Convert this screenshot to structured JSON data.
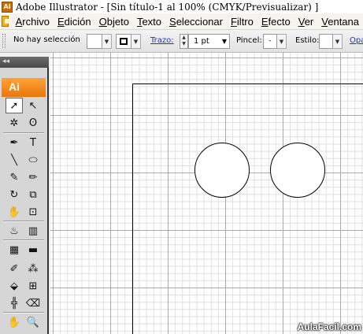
{
  "window": {
    "logo": "Ai",
    "title": "Adobe Illustrator - [Sin título-1 al 100% (CMYK/Previsualizar) ]"
  },
  "menubar": {
    "items": [
      "Archivo",
      "Edición",
      "Objeto",
      "Texto",
      "Seleccionar",
      "Filtro",
      "Efecto",
      "Ver",
      "Ventana"
    ]
  },
  "controlbar": {
    "selection_status": "No hay selección",
    "fill_color": "#ffffff",
    "stroke_color": "#000000",
    "stroke_label": "Trazo:",
    "stroke_weight": "1 pt",
    "brush_label": "Pincel:",
    "brush_value": "-",
    "style_label": "Estilo:",
    "opacity_label": "Opa"
  },
  "tools_panel": {
    "collapse_glyph": "◂◂",
    "logo": "Ai",
    "tools": [
      {
        "name": "selection-tool",
        "glyph": "➚",
        "active": true
      },
      {
        "name": "direct-selection-tool",
        "glyph": "↖"
      },
      {
        "name": "magic-wand-tool",
        "glyph": "✲"
      },
      {
        "name": "lasso-tool",
        "glyph": "ʘ"
      },
      {
        "name": "pen-tool",
        "glyph": "✒"
      },
      {
        "name": "type-tool",
        "glyph": "T"
      },
      {
        "name": "line-tool",
        "glyph": "╲"
      },
      {
        "name": "ellipse-tool",
        "glyph": "⬭"
      },
      {
        "name": "paintbrush-tool",
        "glyph": "✎"
      },
      {
        "name": "pencil-tool",
        "glyph": "✏"
      },
      {
        "name": "rotate-tool",
        "glyph": "↻"
      },
      {
        "name": "scale-tool",
        "glyph": "⧉"
      },
      {
        "name": "warp-tool",
        "glyph": "✋"
      },
      {
        "name": "free-transform-tool",
        "glyph": "⊡"
      },
      {
        "name": "symbol-sprayer-tool",
        "glyph": "♨"
      },
      {
        "name": "column-graph-tool",
        "glyph": "▥"
      },
      {
        "name": "mesh-tool",
        "glyph": "▦"
      },
      {
        "name": "gradient-tool",
        "glyph": "▬"
      },
      {
        "name": "eyedropper-tool",
        "glyph": "✐"
      },
      {
        "name": "blend-tool",
        "glyph": "⁂"
      },
      {
        "name": "live-paint-bucket-tool",
        "glyph": "⬙"
      },
      {
        "name": "live-paint-selection-tool",
        "glyph": "⊞"
      },
      {
        "name": "slice-tool",
        "glyph": "╬"
      },
      {
        "name": "eraser-tool",
        "glyph": "⌫"
      },
      {
        "name": "hand-tool",
        "glyph": "✋"
      },
      {
        "name": "zoom-tool",
        "glyph": "🔍"
      }
    ]
  },
  "canvas": {
    "shapes": [
      "circle",
      "circle"
    ]
  },
  "watermark": "AulaFacil.com"
}
